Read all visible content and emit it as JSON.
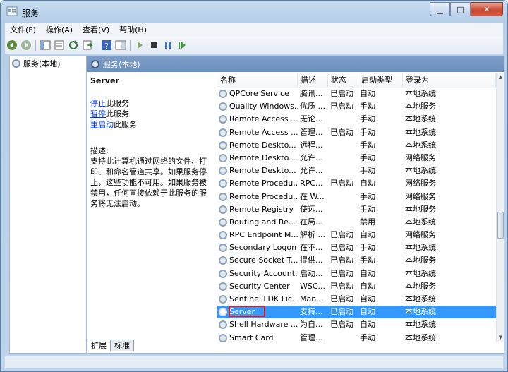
{
  "window": {
    "title": "服务",
    "min_glyph": "▁",
    "max_glyph": "□",
    "close_glyph": "✕"
  },
  "menu": [
    {
      "label": "文件(F)"
    },
    {
      "label": "操作(A)"
    },
    {
      "label": "查看(V)"
    },
    {
      "label": "帮助(H)"
    }
  ],
  "tree": {
    "item": "服务(本地)"
  },
  "main": {
    "header": "服务(本地)",
    "service_name": "Server",
    "actions": [
      {
        "link": "停止",
        "suffix": "此服务"
      },
      {
        "link": "暂停",
        "suffix": "此服务"
      },
      {
        "link": "重启动",
        "suffix": "此服务"
      }
    ],
    "desc_label": "描述:",
    "desc_text": "支持此计算机通过网络的文件、打印、和命名管道共享。如果服务停止，这些功能不可用。如果服务被禁用，任何直接依赖于此服务的服务将无法启动。"
  },
  "columns": [
    "名称",
    "描述",
    "状态",
    "启动类型",
    "登录为"
  ],
  "rows": [
    {
      "name": "QPCore Service",
      "desc": "腾讯...",
      "status": "已启动",
      "startup": "自动",
      "logon": "本地系统"
    },
    {
      "name": "Quality Windows...",
      "desc": "优质 ...",
      "status": "已启动",
      "startup": "手动",
      "logon": "本地服务"
    },
    {
      "name": "Remote Access ...",
      "desc": "无论...",
      "status": "",
      "startup": "手动",
      "logon": "本地系统"
    },
    {
      "name": "Remote Access ...",
      "desc": "管理...",
      "status": "已启动",
      "startup": "手动",
      "logon": "本地系统"
    },
    {
      "name": "Remote Deskto...",
      "desc": "远程...",
      "status": "",
      "startup": "手动",
      "logon": "本地系统"
    },
    {
      "name": "Remote Deskto...",
      "desc": "允许...",
      "status": "",
      "startup": "手动",
      "logon": "网络服务"
    },
    {
      "name": "Remote Deskto...",
      "desc": "允许...",
      "status": "",
      "startup": "手动",
      "logon": "本地系统"
    },
    {
      "name": "Remote Procedu...",
      "desc": "RPC...",
      "status": "已启动",
      "startup": "自动",
      "logon": "网络服务"
    },
    {
      "name": "Remote Procedu...",
      "desc": "在 W...",
      "status": "",
      "startup": "手动",
      "logon": "网络服务"
    },
    {
      "name": "Remote Registry",
      "desc": "使远...",
      "status": "",
      "startup": "手动",
      "logon": "本地服务"
    },
    {
      "name": "Routing and Re...",
      "desc": "在局...",
      "status": "",
      "startup": "禁用",
      "logon": "本地系统"
    },
    {
      "name": "RPC Endpoint M...",
      "desc": "解析 ...",
      "status": "已启动",
      "startup": "自动",
      "logon": "网络服务"
    },
    {
      "name": "Secondary Logon",
      "desc": "在不...",
      "status": "已启动",
      "startup": "手动",
      "logon": "本地系统"
    },
    {
      "name": "Secure Socket T...",
      "desc": "提供...",
      "status": "已启动",
      "startup": "手动",
      "logon": "本地服务"
    },
    {
      "name": "Security Account...",
      "desc": "启动...",
      "status": "已启动",
      "startup": "自动",
      "logon": "本地系统"
    },
    {
      "name": "Security Center",
      "desc": "WSC...",
      "status": "已启动",
      "startup": "自动",
      "logon": "本地服务"
    },
    {
      "name": "Sentinel LDK Lic...",
      "desc": "Man...",
      "status": "已启动",
      "startup": "自动",
      "logon": "本地系统"
    },
    {
      "name": "Server",
      "desc": "支持...",
      "status": "已启动",
      "startup": "自动",
      "logon": "本地系统",
      "selected": true
    },
    {
      "name": "Shell Hardware ...",
      "desc": "为自...",
      "status": "已启动",
      "startup": "自动",
      "logon": "本地系统"
    },
    {
      "name": "Smart Card",
      "desc": "管理...",
      "status": "",
      "startup": "手动",
      "logon": "本地系统"
    }
  ],
  "tabs": [
    "扩展",
    "标准"
  ],
  "colors": {
    "selection": "#3399ff",
    "highlight_box": "#e01919",
    "header": "#6c8fbd"
  }
}
